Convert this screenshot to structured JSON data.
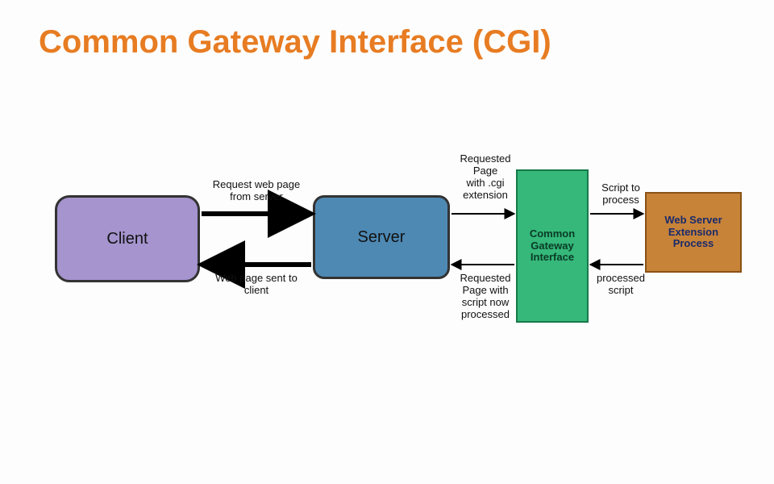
{
  "title": "Common Gateway Interface (CGI)",
  "nodes": {
    "client": "Client",
    "server": "Server",
    "cgi": "Common\nGateway\nInterface",
    "wsep": "Web Server\nExtension\nProcess"
  },
  "edges": {
    "req_web_page": "Request web page\nfrom server",
    "page_sent": "Web page sent to\nclient",
    "req_cgi_ext": "Requested\nPage\nwith .cgi\nextension",
    "req_processed": "Requested\nPage with\nscript now\nprocessed",
    "script_to_process": "Script to\nprocess",
    "processed_script": "processed\nscript"
  }
}
